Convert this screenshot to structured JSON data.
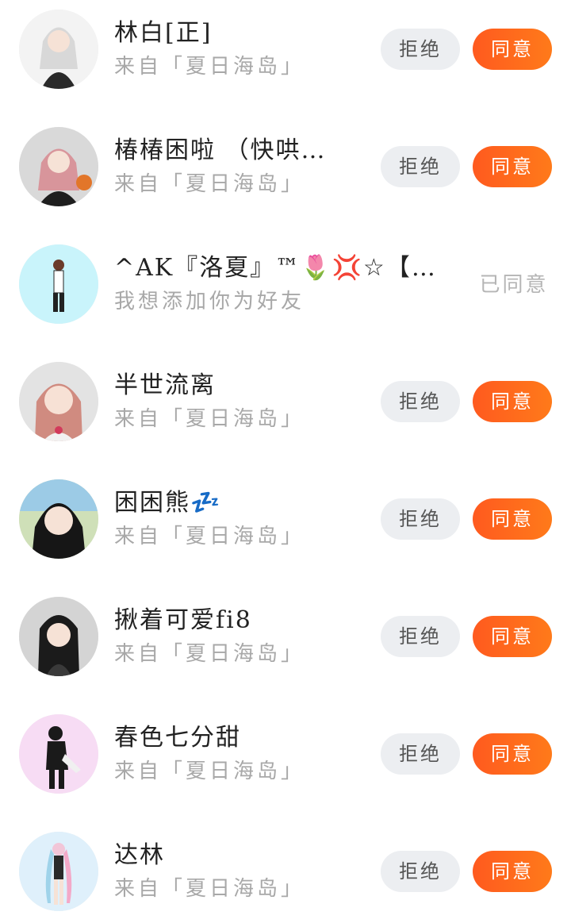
{
  "requests": [
    {
      "name": "林白[正]",
      "source": "来自「夏日海岛」",
      "status": "pending",
      "avatar_bg": "#f3f3f3"
    },
    {
      "name": "椿椿困啦 （快哄…",
      "source": "来自「夏日海岛」",
      "status": "pending",
      "avatar_bg": "#d9d9d9"
    },
    {
      "name": "^AK『洛夏』™🌷💢☆【…",
      "source": "我想添加你为好友",
      "status": "accepted",
      "avatar_bg": "#c9f4fb"
    },
    {
      "name": "半世流离",
      "source": "来自「夏日海岛」",
      "status": "pending",
      "avatar_bg": "#e3e3e3"
    },
    {
      "name": "困困熊💤",
      "source": "来自「夏日海岛」",
      "status": "pending",
      "avatar_bg": "#cfe0b8"
    },
    {
      "name": "揪着可爱fi8",
      "source": "来自「夏日海岛」",
      "status": "pending",
      "avatar_bg": "#d4d4d4"
    },
    {
      "name": "春色七分甜",
      "source": "来自「夏日海岛」",
      "status": "pending",
      "avatar_bg": "#f7dcf4"
    },
    {
      "name": "达林",
      "source": "来自「夏日海岛」",
      "status": "pending",
      "avatar_bg": "#dff0fb"
    }
  ],
  "labels": {
    "reject": "拒绝",
    "accept": "同意",
    "accepted": "已同意"
  },
  "colors": {
    "accent": "#ff5a1f",
    "reject_bg": "#eceef1",
    "secondary_text": "#a8a8a8"
  },
  "icons": {
    "avatar": "user-avatar-icon"
  }
}
